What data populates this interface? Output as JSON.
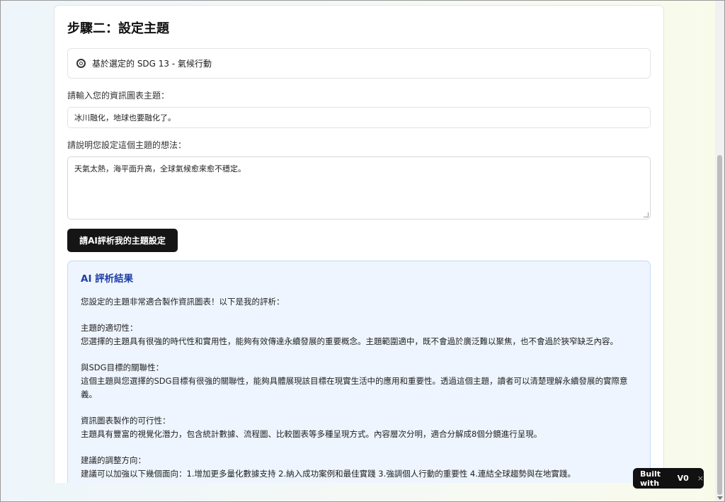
{
  "step_title": "步驟二：設定主題",
  "sdg_banner": "基於選定的 SDG 13 - 氣候行動",
  "topic": {
    "label": "請輸入您的資訊圖表主題：",
    "value": "冰川融化，地球也要融化了。"
  },
  "idea": {
    "label": "請說明您設定這個主題的想法：",
    "value": "天氣太熱，海平面升高，全球氣候愈來愈不穩定。"
  },
  "evaluate_button": "請AI評析我的主題設定",
  "result": {
    "title": "AI 評析結果",
    "intro": "您設定的主題非常適合製作資訊圖表！以下是我的評析：",
    "sections": [
      {
        "heading": "主題的適切性：",
        "body": "您選擇的主題具有很強的時代性和實用性，能夠有效傳達永續發展的重要概念。主題範圍適中，既不會過於廣泛難以聚焦，也不會過於狹窄缺乏內容。"
      },
      {
        "heading": "與SDG目標的關聯性：",
        "body": "這個主題與您選擇的SDG目標有很強的關聯性，能夠具體展現該目標在現實生活中的應用和重要性。透過這個主題，讀者可以清楚理解永續發展的實際意義。"
      },
      {
        "heading": "資訊圖表製作的可行性：",
        "body": "主題具有豐富的視覺化潛力，包含統計數據、流程圖、比較圖表等多種呈現方式。內容層次分明，適合分解成8個分鏡進行呈現。"
      },
      {
        "heading": "建議的調整方向：",
        "body": "建議可以加強以下幾個面向：1.增加更多量化數據支持 2.納入成功案例和最佳實踐 3.強調個人行動的重要性 4.連結全球趨勢與在地實踐。"
      }
    ]
  },
  "badge": {
    "label": "Built with",
    "logo": "V0",
    "close": "×"
  }
}
